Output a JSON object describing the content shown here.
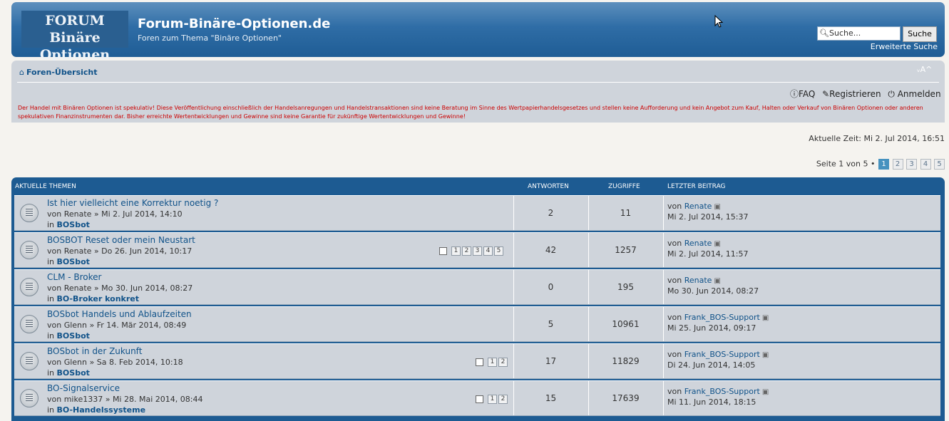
{
  "header": {
    "logo_line1": "FORUM",
    "logo_line2": "Binäre Optionen",
    "site_title": "Forum-Binäre-Optionen.de",
    "site_description": "Foren zum Thema \"Binäre Optionen\"",
    "search_placeholder": "Suche...",
    "search_button": "Suche",
    "advanced_search": "Erweiterte Suche"
  },
  "navbar": {
    "breadcrumb": "Foren-Übersicht",
    "font_size_toggle": "ᵥA^",
    "faq": "FAQ",
    "register": "Registrieren",
    "login": "Anmelden",
    "disclaimer": "Der Handel mit Binären Optionen ist spekulativ! Diese Veröffentlichung einschließlich der Handelsanregungen und Handelstransaktionen sind keine Beratung im Sinne des Wertpapierhandelsgesetzes und stellen keine Aufforderung und kein Angebot zum Kauf, Halten oder Verkauf von Binären Optionen oder anderen spekulativen Finanzinstrumenten dar. Bisher erreichte Wertentwicklungen und Gewinne sind keine Garantie für zukünftige Wertentwicklungen und Gewinne!"
  },
  "current_time": "Aktuelle Zeit: Mi 2. Jul 2014, 16:51",
  "pagination": {
    "label": "Seite 1 von 5 •",
    "pages": [
      "1",
      "2",
      "3",
      "4",
      "5"
    ],
    "active": "1"
  },
  "topics_header": {
    "title": "AKTUELLE THEMEN",
    "replies": "ANTWORTEN",
    "views": "ZUGRIFFE",
    "last_post": "LETZTER BEITRAG"
  },
  "topics": [
    {
      "title": "Ist hier vielleicht eine Korrektur noetig ?",
      "meta": "von Renate » Mi 2. Jul 2014, 14:10",
      "in": "in",
      "forum": "BOSbot",
      "pages": [],
      "replies": "2",
      "views": "11",
      "last_by_prefix": "von",
      "last_author": "Renate",
      "last_time": "Mi 2. Jul 2014, 15:37"
    },
    {
      "title": "BOSBOT Reset oder mein Neustart",
      "meta": "von Renate » Do 26. Jun 2014, 10:17",
      "in": "in",
      "forum": "BOSbot",
      "pages": [
        "1",
        "2",
        "3",
        "4",
        "5"
      ],
      "replies": "42",
      "views": "1257",
      "last_by_prefix": "von",
      "last_author": "Renate",
      "last_time": "Mi 2. Jul 2014, 11:57"
    },
    {
      "title": "CLM - Broker",
      "meta": "von Renate » Mo 30. Jun 2014, 08:27",
      "in": "in",
      "forum": "BO-Broker konkret",
      "pages": [],
      "replies": "0",
      "views": "195",
      "last_by_prefix": "von",
      "last_author": "Renate",
      "last_time": "Mo 30. Jun 2014, 08:27"
    },
    {
      "title": "BOSbot Handels und Ablaufzeiten",
      "meta": "von Glenn » Fr 14. Mär 2014, 08:49",
      "in": "in",
      "forum": "BOSbot",
      "pages": [],
      "replies": "5",
      "views": "10961",
      "last_by_prefix": "von",
      "last_author": "Frank_BOS-Support",
      "last_time": "Mi 25. Jun 2014, 09:17"
    },
    {
      "title": "BOSbot in der Zukunft",
      "meta": "von Glenn » Sa 8. Feb 2014, 10:18",
      "in": "in",
      "forum": "BOSbot",
      "pages": [
        "1",
        "2"
      ],
      "replies": "17",
      "views": "11829",
      "last_by_prefix": "von",
      "last_author": "Frank_BOS-Support",
      "last_time": "Di 24. Jun 2014, 14:05"
    },
    {
      "title": "BO-Signalservice",
      "meta": "von mike1337 » Mi 28. Mai 2014, 08:44",
      "in": "in",
      "forum": "BO-Handelssysteme",
      "pages": [
        "1",
        "2"
      ],
      "replies": "15",
      "views": "17639",
      "last_by_prefix": "von",
      "last_author": "Frank_BOS-Support",
      "last_time": "Mi 11. Jun 2014, 18:15"
    }
  ]
}
